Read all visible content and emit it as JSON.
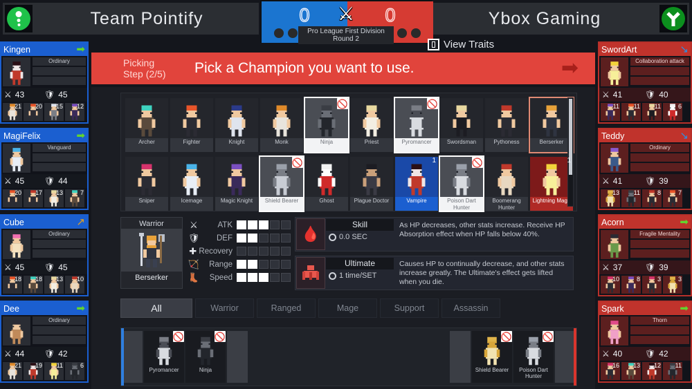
{
  "header": {
    "left_team": "Team Pointify",
    "right_team": "Ybox Gaming",
    "left_logo_icon": "green-circle-dots-logo",
    "right_logo_icon": "green-y-logo",
    "score_left": "0",
    "score_right": "0",
    "match_label": "Pro League First Division Round 2",
    "vs_icon": "crossed-swords-icon",
    "view_traits_label": "View Traits",
    "view_traits_key": "D",
    "colors": {
      "blue": "#1b75d0",
      "red": "#d63b33",
      "banner": "#e1443c"
    }
  },
  "banner": {
    "step_line1": "Picking",
    "step_line2": "Step (2/5)",
    "message": "Pick a Champion you want to use.",
    "arrow_icon": "arrow-right-icon"
  },
  "grid": {
    "row1": [
      {
        "name": "Archer",
        "state": "normal",
        "sprite": "archer"
      },
      {
        "name": "Fighter",
        "state": "normal",
        "sprite": "fighter"
      },
      {
        "name": "Knight",
        "state": "normal",
        "sprite": "knight"
      },
      {
        "name": "Monk",
        "state": "normal",
        "sprite": "monk"
      },
      {
        "name": "Ninja",
        "state": "banned-selected",
        "sprite": "ninja"
      },
      {
        "name": "Priest",
        "state": "normal",
        "sprite": "priest"
      },
      {
        "name": "Pyromancer",
        "state": "banned-selected",
        "sprite": "pyromancer"
      },
      {
        "name": "Swordsman",
        "state": "normal",
        "sprite": "swordsman"
      },
      {
        "name": "Pythoness",
        "state": "normal",
        "sprite": "pythoness"
      },
      {
        "name": "Berserker",
        "state": "highlighted",
        "sprite": "berserker"
      }
    ],
    "row2": [
      {
        "name": "Sniper",
        "state": "normal",
        "sprite": "sniper"
      },
      {
        "name": "Icemage",
        "state": "normal",
        "sprite": "icemage"
      },
      {
        "name": "Magic Knight",
        "state": "normal",
        "sprite": "magicknight"
      },
      {
        "name": "Shield Bearer",
        "state": "banned-selected",
        "sprite": "shieldbearer"
      },
      {
        "name": "Ghost",
        "state": "normal",
        "sprite": "ghost"
      },
      {
        "name": "Plague Doctor",
        "state": "normal",
        "sprite": "plaguedoctor"
      },
      {
        "name": "Vampire",
        "state": "picked-blue",
        "badge": "1",
        "sprite": "vampire"
      },
      {
        "name": "Poison Dart Hunter",
        "state": "banned-selected",
        "sprite": "poisondart"
      },
      {
        "name": "Boomerang Hunter",
        "state": "normal",
        "sprite": "boomerang"
      },
      {
        "name": "Lightning Mage",
        "state": "picked-red",
        "badge": "1",
        "sprite": "lightningmage"
      }
    ],
    "ban_icon": "no-entry-icon"
  },
  "detail": {
    "role": "Warrior",
    "champion": "Berserker",
    "stats": [
      {
        "label": "ATK",
        "icon": "crossed-swords-icon",
        "value": 3,
        "max": 5
      },
      {
        "label": "DEF",
        "icon": "shield-icon",
        "value": 2,
        "max": 5
      },
      {
        "label": "Recovery",
        "icon": "plus-cross-icon",
        "value": 0,
        "max": 5
      },
      {
        "label": "Range",
        "icon": "bow-icon",
        "value": 2,
        "max": 5
      },
      {
        "label": "Speed",
        "icon": "boot-icon",
        "value": 3,
        "max": 5
      }
    ],
    "skill": {
      "title": "Skill",
      "cost": "0.0 SEC",
      "icon": "red-blood-drop-up-icon",
      "description": "As HP decreases, other stats increase. Receive HP Absorption effect when HP falls below 40%."
    },
    "ultimate": {
      "title": "Ultimate",
      "cost": "1 time/SET",
      "icon": "red-armored-figure-icon",
      "description": "Causes HP to continually decrease, and other stats increase greatly. The Ultimate's effect gets lifted when you die."
    }
  },
  "filters": [
    {
      "label": "All",
      "active": true
    },
    {
      "label": "Warrior",
      "active": false
    },
    {
      "label": "Ranged",
      "active": false
    },
    {
      "label": "Mage",
      "active": false
    },
    {
      "label": "Support",
      "active": false
    },
    {
      "label": "Assassin",
      "active": false
    }
  ],
  "draft": {
    "blue_picks": [
      {
        "name": "Pyromancer",
        "banned": true,
        "sprite": "pyromancer"
      },
      {
        "name": "Ninja",
        "banned": true,
        "sprite": "ninja"
      }
    ],
    "red_picks": [
      {
        "name": "Shield Bearer",
        "banned": true,
        "sprite": "shieldbearer_gold"
      },
      {
        "name": "Poison Dart Hunter",
        "banned": true,
        "sprite": "poisondart"
      }
    ]
  },
  "left_players": [
    {
      "name": "Kingen",
      "arrow": "arrow-right-icon",
      "arrow_color": "#62d52e",
      "trait": "Ordinary",
      "atk": "43",
      "def": "45",
      "minis": [
        {
          "value": "21",
          "sprite": "monk"
        },
        {
          "value": "20",
          "sprite": "fighter"
        },
        {
          "value": "15",
          "sprite": "ghostboy"
        },
        {
          "value": "12",
          "sprite": "magicknight"
        }
      ],
      "avatar": "vampire"
    },
    {
      "name": "MagiFelix",
      "arrow": "arrow-right-icon",
      "arrow_color": "#62d52e",
      "trait": "Vanguard",
      "atk": "45",
      "def": "44",
      "minis": [
        {
          "value": "20",
          "sprite": "fighter"
        },
        {
          "value": "17",
          "sprite": "pythoness"
        },
        {
          "value": "13",
          "sprite": "priest"
        },
        {
          "value": "7",
          "sprite": "archer"
        }
      ],
      "avatar": "icemage"
    },
    {
      "name": "Cube",
      "arrow": "arrow-up-right-icon",
      "arrow_color": "#e8a21c",
      "trait": "Ordinary",
      "atk": "45",
      "def": "45",
      "minis": [
        {
          "value": "18",
          "sprite": "fighter"
        },
        {
          "value": "18",
          "sprite": "archer"
        },
        {
          "value": "13",
          "sprite": "priest"
        },
        {
          "value": "10",
          "sprite": "boomerang"
        }
      ],
      "avatar": "pinkmage"
    },
    {
      "name": "Dee",
      "arrow": "arrow-right-icon",
      "arrow_color": "#62d52e",
      "trait": "Ordinary",
      "atk": "44",
      "def": "42",
      "minis": [
        {
          "value": "21",
          "sprite": "monk"
        },
        {
          "value": "19",
          "sprite": "vampire"
        },
        {
          "value": "11",
          "sprite": "lightningmage"
        },
        {
          "value": "6",
          "sprite": "ninja"
        }
      ],
      "avatar": "darkboy"
    }
  ],
  "right_players": [
    {
      "name": "SwordArt",
      "arrow": "arrow-down-right-icon",
      "arrow_color": "#2f8fe0",
      "trait": "Collaboration attack",
      "atk": "41",
      "def": "40",
      "minis": [
        {
          "value": "11",
          "sprite": "magicknight"
        },
        {
          "value": "11",
          "sprite": "fighter"
        },
        {
          "value": "11",
          "sprite": "swordsman"
        },
        {
          "value": "6",
          "sprite": "ghost"
        }
      ],
      "avatar": "lightningmage"
    },
    {
      "name": "Teddy",
      "arrow": "arrow-down-right-icon",
      "arrow_color": "#2f8fe0",
      "trait": "Ordinary",
      "atk": "41",
      "def": "39",
      "minis": [
        {
          "value": "13",
          "sprite": "shieldbearer_gold"
        },
        {
          "value": "11",
          "sprite": "ninja"
        },
        {
          "value": "8",
          "sprite": "pythoness"
        },
        {
          "value": "7",
          "sprite": "fighter"
        }
      ],
      "avatar": "purplemage"
    },
    {
      "name": "Acorn",
      "arrow": "arrow-right-icon",
      "arrow_color": "#62d52e",
      "trait": "Fragile Mentality",
      "atk": "37",
      "def": "39",
      "minis": [
        {
          "value": "10",
          "sprite": "sniper"
        },
        {
          "value": "8",
          "sprite": "magicknight"
        },
        {
          "value": "3",
          "sprite": "sniper"
        },
        {
          "value": "3",
          "sprite": "shieldbearer_gold"
        }
      ],
      "avatar": "darkboy2"
    },
    {
      "name": "Spark",
      "arrow": "arrow-right-icon",
      "arrow_color": "#62d52e",
      "trait": "Thorn",
      "atk": "40",
      "def": "42",
      "minis": [
        {
          "value": "16",
          "sprite": "sniper"
        },
        {
          "value": "13",
          "sprite": "archer"
        },
        {
          "value": "12",
          "sprite": "vampire"
        },
        {
          "value": "11",
          "sprite": "ninja"
        }
      ],
      "avatar": "pinkmage2"
    }
  ]
}
